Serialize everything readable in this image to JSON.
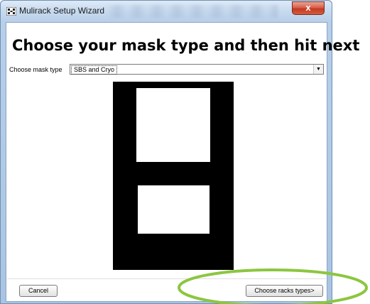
{
  "window": {
    "title": "Mulirack Setup Wizard",
    "close_symbol": "x",
    "app_icon": "wizard-grid-icon"
  },
  "main": {
    "heading": "Choose your mask type and then hit next",
    "mask_type": {
      "label": "Choose mask type",
      "selected": "SBS and Cryo",
      "arrow_glyph": "▼"
    }
  },
  "buttons": {
    "cancel": "Cancel",
    "next": "Choose racks types>"
  },
  "colors": {
    "highlight": "#8cc63f",
    "mask_black": "#000000",
    "mask_white": "#ffffff",
    "close_red": "#c23a22"
  }
}
